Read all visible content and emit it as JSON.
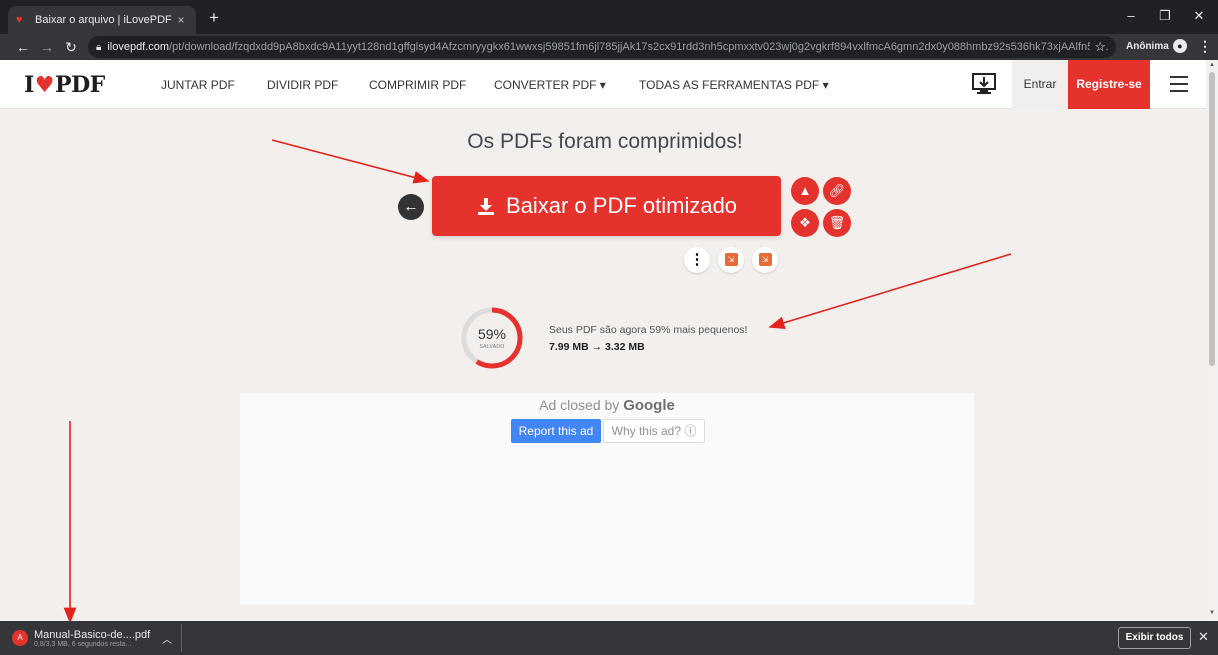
{
  "browser": {
    "tab_title": "Baixar o arquivo | iLovePDF",
    "tab_close": "×",
    "new_tab": "+",
    "url_host": "ilovepdf.com",
    "url_path": "/pt/download/fzqdxdd9pA8bxdc9A11yyt128nd1gffglsyd4Afzcmryygkx61wwxsj59851fm6jl785jjAk17s2cx91rdd3nh5cpmxxtv023wj0g2vgkrf894vxlfmcA6gmn2dx0y088hmbz92s536hk73xjAAlfn54...",
    "profile_label": "Anônima",
    "win_min": "–",
    "win_max": "❐",
    "win_close": "✕"
  },
  "site": {
    "logo_left": "I",
    "logo_right": "PDF",
    "nav": [
      "JUNTAR PDF",
      "DIVIDIR PDF",
      "COMPRIMIR PDF",
      "CONVERTER PDF ▾",
      "TODAS AS FERRAMENTAS PDF ▾"
    ],
    "login_label": "Entrar",
    "signup_label": "Registre-se"
  },
  "main": {
    "heading": "Os PDFs foram comprimidos!",
    "download_label": "Baixar o PDF otimizado",
    "savings_percent": "59%",
    "savings_percent_value": 59,
    "savings_label": "SALVADO",
    "savings_text": "Seus PDF são agora 59% mais pequenos!",
    "size_before": "7.99 MB",
    "size_after": "3.32 MB"
  },
  "ad": {
    "closed_text": "Ad closed by",
    "closed_brand": "Google",
    "report_label": "Report this ad",
    "why_label": "Why this ad? ⓘ"
  },
  "download_bar": {
    "file_name": "Manual-Basico-de....pdf",
    "file_status": "0,8/3,3 MB, 6 segundos resta...",
    "show_all_label": "Exibir todos"
  },
  "colors": {
    "brand_red": "#e5322d",
    "page_bg": "#f2efec",
    "chrome_dark": "#202124"
  }
}
